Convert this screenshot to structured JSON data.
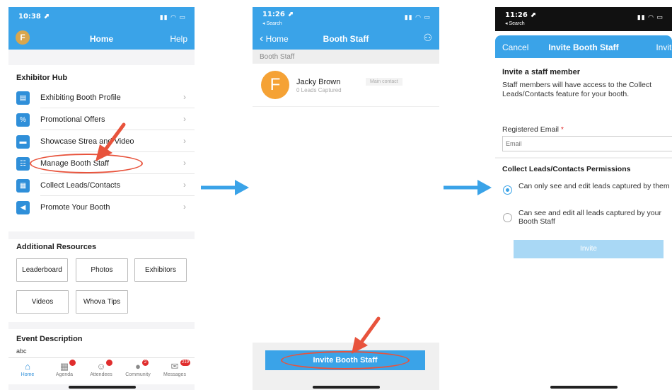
{
  "phone1": {
    "status_time": "10:38 ⬈",
    "status_icons": "▮▮ ◠ ▭",
    "avatar_letter": "F",
    "nav_title": "Home",
    "nav_right": "Help",
    "hub_title": "Exhibitor Hub",
    "hub_items": [
      {
        "label": "Exhibiting Booth Profile",
        "icon": "profile-icon"
      },
      {
        "label": "Promotional Offers",
        "icon": "offers-icon"
      },
      {
        "label": "Showcase Strea   and Video",
        "icon": "video-icon"
      },
      {
        "label": "Manage Booth Staff",
        "icon": "staff-icon"
      },
      {
        "label": "Collect Leads/Contacts",
        "icon": "qr-icon"
      },
      {
        "label": "Promote Your Booth",
        "icon": "megaphone-icon"
      }
    ],
    "resources_title": "Additional Resources",
    "resources": [
      "Leaderboard",
      "Photos",
      "Exhibitors",
      "Videos",
      "Whova Tips"
    ],
    "event_title": "Event Description",
    "event_text": "abc",
    "tabs": [
      {
        "label": "Home",
        "badge": ""
      },
      {
        "label": "Agenda",
        "badge": ""
      },
      {
        "label": "Attendees",
        "badge": ""
      },
      {
        "label": "Community",
        "badge": "2"
      },
      {
        "label": "Messages",
        "badge": "219"
      }
    ]
  },
  "phone2": {
    "status_time": "11:26 ⬈",
    "status_sub": "◂ Search",
    "status_icons": "▮▮ ◠ ▭",
    "nav_back": "Home",
    "nav_title": "Booth Staff",
    "section_header": "Booth Staff",
    "staff": {
      "initial": "F",
      "name": "Jacky Brown",
      "sub": "0 Leads Captured",
      "tag": "Main contact"
    },
    "invite_button": "Invite Booth Staff"
  },
  "phone3": {
    "status_time": "11:26 ⬈",
    "status_sub": "◂ Search",
    "status_icons": "▮▮ ◠ ▭",
    "nav_left": "Cancel",
    "nav_title": "Invite Booth Staff",
    "nav_right": "Invite",
    "title": "Invite a staff member",
    "description": "Staff members will have access to the Collect Leads/Contacts feature for your booth.",
    "email_label": "Registered Email",
    "email_required": "*",
    "email_placeholder": "Email",
    "perm_title": "Collect Leads/Contacts Permissions",
    "option1": "Can only see and edit leads captured by them",
    "option2": "Can see and edit all leads captured by your Booth Staff",
    "selected_option": 1,
    "invite_button": "Invite"
  },
  "colors": {
    "primary": "#3aa3e8",
    "accent_red": "#e8533c",
    "badge_red": "#e02d2d",
    "avatar_orange": "#f5a235"
  }
}
